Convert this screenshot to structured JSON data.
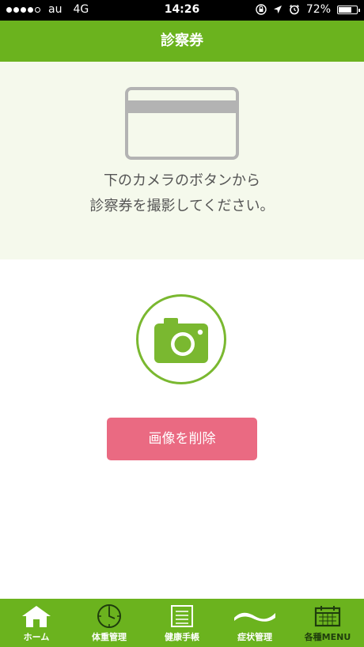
{
  "status_bar": {
    "signal_bars_filled": 4,
    "signal_bars_total": 5,
    "carrier": "au",
    "network": "4G",
    "time": "14:26",
    "icons": [
      "orientation-lock-icon",
      "location-arrow-icon",
      "alarm-icon"
    ],
    "battery_percent": "72%",
    "battery_level": 0.72
  },
  "header": {
    "title": "診察券"
  },
  "instructions": {
    "line1": "下のカメラのボタンから",
    "line2": "診察券を撮影してください。"
  },
  "actions": {
    "camera_icon": "camera-icon",
    "delete_label": "画像を削除"
  },
  "colors": {
    "accent_green": "#6bb31e",
    "panel_bg": "#f5f9ec",
    "delete_pink": "#ea6a82"
  },
  "tab_bar": {
    "tabs": [
      {
        "label": "ホーム",
        "icon": "home-icon"
      },
      {
        "label": "体重管理",
        "icon": "clock-icon"
      },
      {
        "label": "健康手帳",
        "icon": "notebook-icon"
      },
      {
        "label": "症状管理",
        "icon": "wave-icon"
      },
      {
        "label": "各種MENU",
        "icon": "calendar-icon"
      }
    ]
  }
}
